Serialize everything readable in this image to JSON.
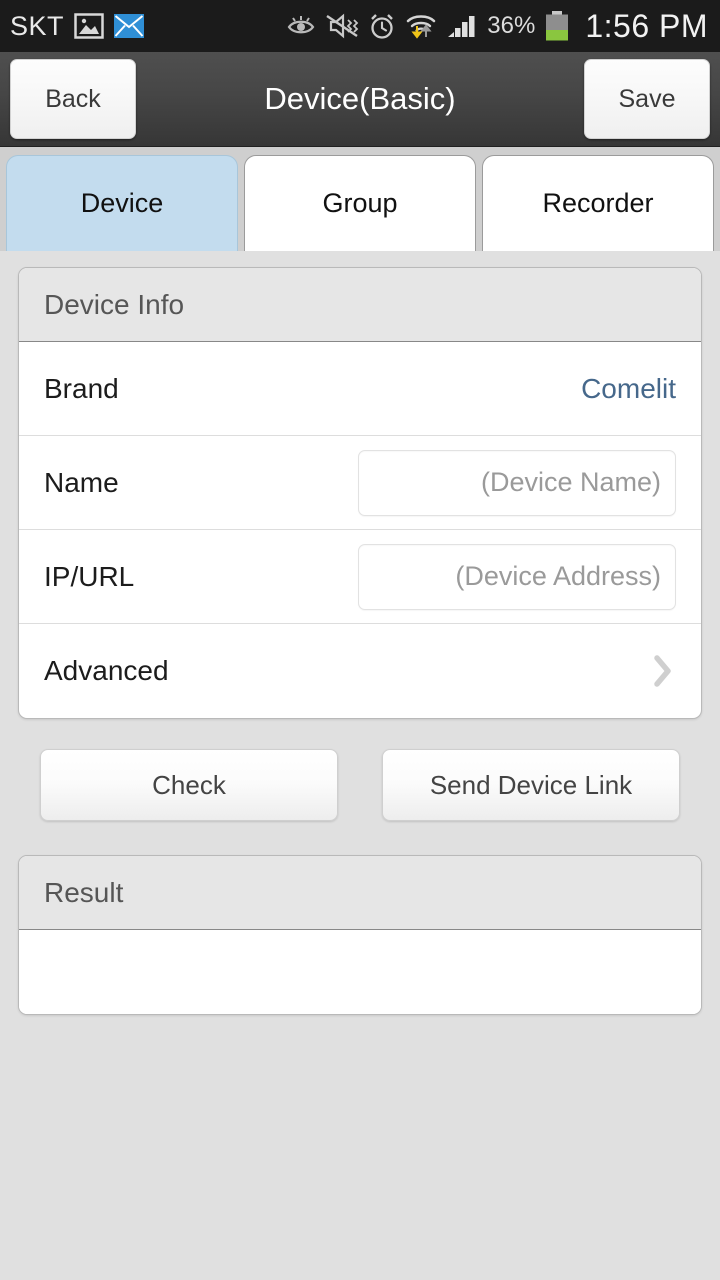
{
  "status_bar": {
    "carrier": "SKT",
    "battery_percent": "36%",
    "time": "1:56 PM",
    "battery_level": 36,
    "left_icons": [
      "gallery-icon",
      "email-icon"
    ],
    "right_icons": [
      "smart-stay-eye-icon",
      "sound-muted-vibrate-icon",
      "alarm-clock-icon",
      "wifi-transfer-icon",
      "cellular-signal-icon",
      "battery-icon"
    ],
    "background_color": "#1b1b1b"
  },
  "title_bar": {
    "back_label": "Back",
    "title": "Device(Basic)",
    "save_label": "Save"
  },
  "tabs": [
    {
      "label": "Device",
      "active": true
    },
    {
      "label": "Group",
      "active": false
    },
    {
      "label": "Recorder",
      "active": false
    }
  ],
  "device_info": {
    "header": "Device Info",
    "rows": {
      "brand": {
        "label": "Brand",
        "value": "Comelit",
        "value_color": "#46688b"
      },
      "name": {
        "label": "Name",
        "value": "",
        "placeholder": "(Device Name)"
      },
      "ip_url": {
        "label": "IP/URL",
        "value": "",
        "placeholder": "(Device Address)"
      },
      "advanced": {
        "label": "Advanced",
        "disclosure_icon": "chevron-right-icon"
      }
    }
  },
  "actions": {
    "check_label": "Check",
    "send_device_link_label": "Send Device Link"
  },
  "result": {
    "header": "Result",
    "body_text": ""
  },
  "theme": {
    "page_background": "#e0e0e0",
    "tab_active_background": "#c3dcee",
    "accent_blue": "#46688b",
    "title_bar_dark": "#464646"
  }
}
